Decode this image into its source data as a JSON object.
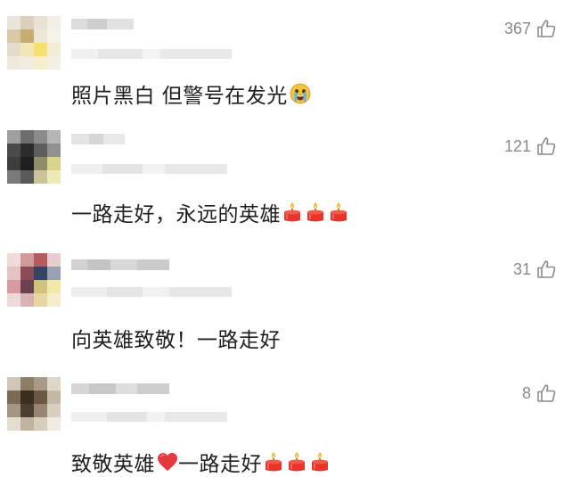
{
  "comments": [
    {
      "likes": "367",
      "text": "照片黑白 但警号在发光",
      "emoji": [
        "crying-face-icon"
      ],
      "avatar_colors": [
        "#e9e4dc",
        "#dcd0bd",
        "#e8e2d6",
        "#f3efe6",
        "#d9c9a8",
        "#c7ab72",
        "#efe7d5",
        "#f5f2ea",
        "#e4dccb",
        "#f2e7b5",
        "#f6e070",
        "#f3ecd6",
        "#efe9dc",
        "#f1ecdf",
        "#f5efcc",
        "#f4f0e5"
      ]
    },
    {
      "likes": "121",
      "text": "一路走好，永远的英雄",
      "emoji": [
        "candle-icon",
        "candle-icon",
        "candle-icon"
      ],
      "avatar_colors": [
        "#9f9f9f",
        "#6d6d6d",
        "#8b8b8b",
        "#b5b5b5",
        "#4a4a4a",
        "#2c2c2c",
        "#5e5e5e",
        "#909090",
        "#3d3d3d",
        "#1f1f1f",
        "#8d8d6a",
        "#d8d48a",
        "#7a7a7a",
        "#5a5a5a",
        "#c9c49a",
        "#eeeab8"
      ]
    },
    {
      "likes": "31",
      "text": "向英雄致敬！一路走好",
      "emoji": [],
      "avatar_colors": [
        "#f1dada",
        "#d49a9a",
        "#b55b62",
        "#e7cfcf",
        "#e5c3c3",
        "#8b4d55",
        "#334466",
        "#9aa0b4",
        "#d89aa0",
        "#6b4050",
        "#cfc27a",
        "#f2e9a8",
        "#efdada",
        "#d8b3b3",
        "#e7d8a3",
        "#f5eecc"
      ]
    },
    {
      "likes": "8",
      "text": "致敬英雄",
      "text_after": "一路走好",
      "emoji": [
        "candle-icon",
        "candle-icon",
        "candle-icon"
      ],
      "avatar_colors": [
        "#cfc6b8",
        "#8f7d66",
        "#a99a86",
        "#ddd6c9",
        "#7c6a55",
        "#3a2e22",
        "#6a5844",
        "#c5b9a6",
        "#a39683",
        "#4d3f30",
        "#978570",
        "#d8cfc0",
        "#e3ddd2",
        "#bfb3a0",
        "#d6cdbd",
        "#efeae2"
      ]
    }
  ],
  "colors": {
    "text": "#1f1f1f",
    "likes": "#8a8a8a",
    "blur_light": "#ececec",
    "blur_mid": "#dedede",
    "heart": "#e5393f",
    "candle_red": "#e8352b",
    "candle_flame": "#f7b733"
  }
}
